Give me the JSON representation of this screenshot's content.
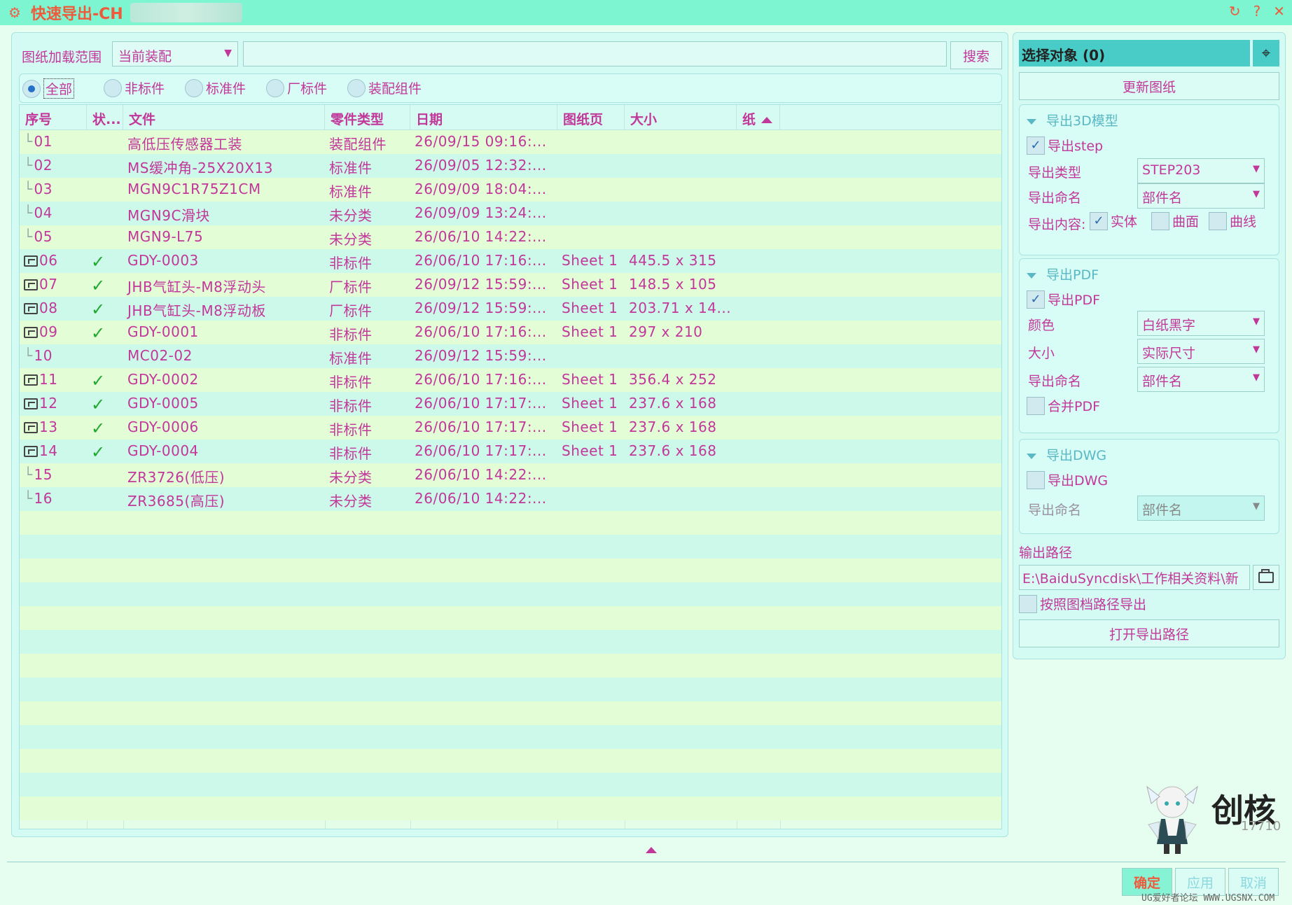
{
  "window": {
    "title": "快速导出-CH",
    "controls": [
      "↻",
      "?",
      "✕"
    ]
  },
  "toolbar": {
    "scope_label": "图纸加载范围",
    "scope_value": "当前装配",
    "search_value": "",
    "search_label": "搜索"
  },
  "filters": [
    {
      "label": "全部",
      "selected": true
    },
    {
      "label": "非标件",
      "selected": false
    },
    {
      "label": "标准件",
      "selected": false
    },
    {
      "label": "厂标件",
      "selected": false
    },
    {
      "label": "装配组件",
      "selected": false
    }
  ],
  "table": {
    "headers": [
      "序号",
      "状...",
      "文件",
      "零件类型",
      "日期",
      "图纸页",
      "大小",
      "纸"
    ],
    "rows": [
      {
        "no": "01",
        "icon": false,
        "status": "",
        "file": "高低压传感器工装",
        "type": "装配组件",
        "date": "26/09/15 09:16:...",
        "sheet": "",
        "size": ""
      },
      {
        "no": "02",
        "icon": false,
        "status": "",
        "file": "MS缓冲角-25X20X13",
        "type": "标准件",
        "date": "26/09/05 12:32:...",
        "sheet": "",
        "size": ""
      },
      {
        "no": "03",
        "icon": false,
        "status": "",
        "file": "MGN9C1R75Z1CM",
        "type": "标准件",
        "date": "26/09/09 18:04:...",
        "sheet": "",
        "size": ""
      },
      {
        "no": "04",
        "icon": false,
        "status": "",
        "file": "MGN9C滑块",
        "type": "未分类",
        "date": "26/09/09 13:24:...",
        "sheet": "",
        "size": ""
      },
      {
        "no": "05",
        "icon": false,
        "status": "",
        "file": "MGN9-L75",
        "type": "未分类",
        "date": "26/06/10 14:22:...",
        "sheet": "",
        "size": ""
      },
      {
        "no": "06",
        "icon": true,
        "status": "✓",
        "file": "GDY-0003",
        "type": "非标件",
        "date": "26/06/10 17:16:...",
        "sheet": "Sheet 1",
        "size": "445.5 x 315"
      },
      {
        "no": "07",
        "icon": true,
        "status": "✓",
        "file": "JHB气缸头-M8浮动头",
        "type": "厂标件",
        "date": "26/09/12 15:59:...",
        "sheet": "Sheet 1",
        "size": "148.5 x 105"
      },
      {
        "no": "08",
        "icon": true,
        "status": "✓",
        "file": "JHB气缸头-M8浮动板",
        "type": "厂标件",
        "date": "26/09/12 15:59:...",
        "sheet": "Sheet 1",
        "size": "203.71 x 14..."
      },
      {
        "no": "09",
        "icon": true,
        "status": "✓",
        "file": "GDY-0001",
        "type": "非标件",
        "date": "26/06/10 17:16:...",
        "sheet": "Sheet 1",
        "size": "297 x 210"
      },
      {
        "no": "10",
        "icon": false,
        "status": "",
        "file": "MC02-02",
        "type": "标准件",
        "date": "26/09/12 15:59:...",
        "sheet": "",
        "size": ""
      },
      {
        "no": "11",
        "icon": true,
        "status": "✓",
        "file": "GDY-0002",
        "type": "非标件",
        "date": "26/06/10 17:16:...",
        "sheet": "Sheet 1",
        "size": "356.4 x 252"
      },
      {
        "no": "12",
        "icon": true,
        "status": "✓",
        "file": "GDY-0005",
        "type": "非标件",
        "date": "26/06/10 17:17:...",
        "sheet": "Sheet 1",
        "size": "237.6 x 168"
      },
      {
        "no": "13",
        "icon": true,
        "status": "✓",
        "file": "GDY-0006",
        "type": "非标件",
        "date": "26/06/10 17:17:...",
        "sheet": "Sheet 1",
        "size": "237.6 x 168"
      },
      {
        "no": "14",
        "icon": true,
        "status": "✓",
        "file": "GDY-0004",
        "type": "非标件",
        "date": "26/06/10 17:17:...",
        "sheet": "Sheet 1",
        "size": "237.6 x 168"
      },
      {
        "no": "15",
        "icon": false,
        "status": "",
        "file": "ZR3726(低压)",
        "type": "未分类",
        "date": "26/06/10 14:22:...",
        "sheet": "",
        "size": ""
      },
      {
        "no": "16",
        "icon": false,
        "status": "",
        "file": "ZR3685(高压)",
        "type": "未分类",
        "date": "26/06/10 14:22:...",
        "sheet": "",
        "size": ""
      }
    ]
  },
  "right": {
    "select_object": "选择对象 (0)",
    "update_drawing": "更新图纸",
    "model3d": {
      "title": "导出3D模型",
      "export_step": {
        "label": "导出step",
        "checked": true
      },
      "type_label": "导出类型",
      "type_value": "STEP203",
      "naming_label": "导出命名",
      "naming_value": "部件名",
      "content_label": "导出内容:",
      "solid": {
        "label": "实体",
        "checked": true
      },
      "surface": {
        "label": "曲面",
        "checked": false
      },
      "curve": {
        "label": "曲线",
        "checked": false
      }
    },
    "pdf": {
      "title": "导出PDF",
      "export_pdf": {
        "label": "导出PDF",
        "checked": true
      },
      "color_label": "颜色",
      "color_value": "白纸黑字",
      "size_label": "大小",
      "size_value": "实际尺寸",
      "naming_label": "导出命名",
      "naming_value": "部件名",
      "merge": {
        "label": "合并PDF",
        "checked": false
      }
    },
    "dwg": {
      "title": "导出DWG",
      "export_dwg": {
        "label": "导出DWG",
        "checked": false
      },
      "naming_label": "导出命名",
      "naming_value": "部件名"
    },
    "output_label": "输出路径",
    "output_path": "E:\\BaiduSyncdisk\\工作相关资料\\新",
    "by_path": {
      "label": "按照图档路径导出",
      "checked": false
    },
    "open_path": "打开导出路径"
  },
  "brand": {
    "name": "创核",
    "number": "17710"
  },
  "footer": {
    "ok": "确定",
    "apply": "应用",
    "cancel": "取消",
    "watermark": "UG爱好者论坛 WWW.UGSNX.COM"
  },
  "colors": {
    "accent": "#c2379a",
    "title_bar": "#7cf5d0",
    "title_text": "#ef5a3c",
    "select_bar": "#49ccc8",
    "check_green": "#21a830"
  }
}
